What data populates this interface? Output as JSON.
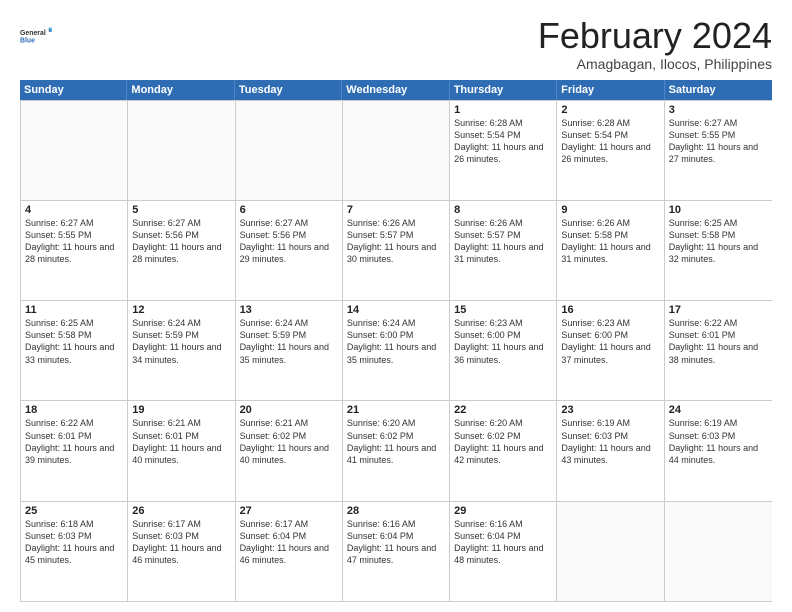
{
  "logo": {
    "general": "General",
    "blue": "Blue"
  },
  "title": "February 2024",
  "location": "Amagbagan, Ilocos, Philippines",
  "days_of_week": [
    "Sunday",
    "Monday",
    "Tuesday",
    "Wednesday",
    "Thursday",
    "Friday",
    "Saturday"
  ],
  "weeks": [
    [
      {
        "day": "",
        "info": ""
      },
      {
        "day": "",
        "info": ""
      },
      {
        "day": "",
        "info": ""
      },
      {
        "day": "",
        "info": ""
      },
      {
        "day": "1",
        "info": "Sunrise: 6:28 AM\nSunset: 5:54 PM\nDaylight: 11 hours and 26 minutes."
      },
      {
        "day": "2",
        "info": "Sunrise: 6:28 AM\nSunset: 5:54 PM\nDaylight: 11 hours and 26 minutes."
      },
      {
        "day": "3",
        "info": "Sunrise: 6:27 AM\nSunset: 5:55 PM\nDaylight: 11 hours and 27 minutes."
      }
    ],
    [
      {
        "day": "4",
        "info": "Sunrise: 6:27 AM\nSunset: 5:55 PM\nDaylight: 11 hours and 28 minutes."
      },
      {
        "day": "5",
        "info": "Sunrise: 6:27 AM\nSunset: 5:56 PM\nDaylight: 11 hours and 28 minutes."
      },
      {
        "day": "6",
        "info": "Sunrise: 6:27 AM\nSunset: 5:56 PM\nDaylight: 11 hours and 29 minutes."
      },
      {
        "day": "7",
        "info": "Sunrise: 6:26 AM\nSunset: 5:57 PM\nDaylight: 11 hours and 30 minutes."
      },
      {
        "day": "8",
        "info": "Sunrise: 6:26 AM\nSunset: 5:57 PM\nDaylight: 11 hours and 31 minutes."
      },
      {
        "day": "9",
        "info": "Sunrise: 6:26 AM\nSunset: 5:58 PM\nDaylight: 11 hours and 31 minutes."
      },
      {
        "day": "10",
        "info": "Sunrise: 6:25 AM\nSunset: 5:58 PM\nDaylight: 11 hours and 32 minutes."
      }
    ],
    [
      {
        "day": "11",
        "info": "Sunrise: 6:25 AM\nSunset: 5:58 PM\nDaylight: 11 hours and 33 minutes."
      },
      {
        "day": "12",
        "info": "Sunrise: 6:24 AM\nSunset: 5:59 PM\nDaylight: 11 hours and 34 minutes."
      },
      {
        "day": "13",
        "info": "Sunrise: 6:24 AM\nSunset: 5:59 PM\nDaylight: 11 hours and 35 minutes."
      },
      {
        "day": "14",
        "info": "Sunrise: 6:24 AM\nSunset: 6:00 PM\nDaylight: 11 hours and 35 minutes."
      },
      {
        "day": "15",
        "info": "Sunrise: 6:23 AM\nSunset: 6:00 PM\nDaylight: 11 hours and 36 minutes."
      },
      {
        "day": "16",
        "info": "Sunrise: 6:23 AM\nSunset: 6:00 PM\nDaylight: 11 hours and 37 minutes."
      },
      {
        "day": "17",
        "info": "Sunrise: 6:22 AM\nSunset: 6:01 PM\nDaylight: 11 hours and 38 minutes."
      }
    ],
    [
      {
        "day": "18",
        "info": "Sunrise: 6:22 AM\nSunset: 6:01 PM\nDaylight: 11 hours and 39 minutes."
      },
      {
        "day": "19",
        "info": "Sunrise: 6:21 AM\nSunset: 6:01 PM\nDaylight: 11 hours and 40 minutes."
      },
      {
        "day": "20",
        "info": "Sunrise: 6:21 AM\nSunset: 6:02 PM\nDaylight: 11 hours and 40 minutes."
      },
      {
        "day": "21",
        "info": "Sunrise: 6:20 AM\nSunset: 6:02 PM\nDaylight: 11 hours and 41 minutes."
      },
      {
        "day": "22",
        "info": "Sunrise: 6:20 AM\nSunset: 6:02 PM\nDaylight: 11 hours and 42 minutes."
      },
      {
        "day": "23",
        "info": "Sunrise: 6:19 AM\nSunset: 6:03 PM\nDaylight: 11 hours and 43 minutes."
      },
      {
        "day": "24",
        "info": "Sunrise: 6:19 AM\nSunset: 6:03 PM\nDaylight: 11 hours and 44 minutes."
      }
    ],
    [
      {
        "day": "25",
        "info": "Sunrise: 6:18 AM\nSunset: 6:03 PM\nDaylight: 11 hours and 45 minutes."
      },
      {
        "day": "26",
        "info": "Sunrise: 6:17 AM\nSunset: 6:03 PM\nDaylight: 11 hours and 46 minutes."
      },
      {
        "day": "27",
        "info": "Sunrise: 6:17 AM\nSunset: 6:04 PM\nDaylight: 11 hours and 46 minutes."
      },
      {
        "day": "28",
        "info": "Sunrise: 6:16 AM\nSunset: 6:04 PM\nDaylight: 11 hours and 47 minutes."
      },
      {
        "day": "29",
        "info": "Sunrise: 6:16 AM\nSunset: 6:04 PM\nDaylight: 11 hours and 48 minutes."
      },
      {
        "day": "",
        "info": ""
      },
      {
        "day": "",
        "info": ""
      }
    ]
  ]
}
